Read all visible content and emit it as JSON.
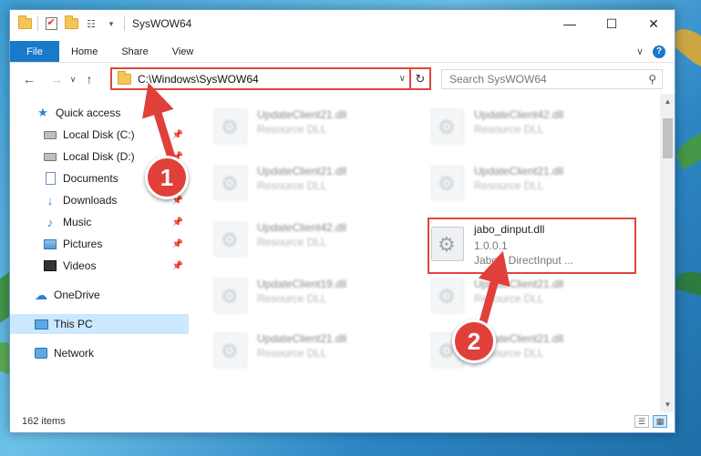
{
  "window": {
    "title": "SysWOW64",
    "controls": {
      "minimize": "—",
      "maximize": "☐",
      "close": "✕"
    }
  },
  "ribbon": {
    "tabs": [
      "File",
      "Home",
      "Share",
      "View"
    ],
    "expand": "∨",
    "help": "?"
  },
  "nav": {
    "back": "←",
    "forward": "→",
    "recent": "∨",
    "up": "↑",
    "address": "C:\\Windows\\SysWOW64",
    "address_dropdown": "∨",
    "refresh": "↻",
    "search_placeholder": "Search SysWOW64"
  },
  "sidebar": {
    "items": [
      {
        "label": "Quick access",
        "icon": "star-icon",
        "pinned": false
      },
      {
        "label": "Local Disk (C:)",
        "icon": "disk-icon",
        "pinned": true
      },
      {
        "label": "Local Disk (D:)",
        "icon": "disk-icon",
        "pinned": true
      },
      {
        "label": "Documents",
        "icon": "documents-icon",
        "pinned": true
      },
      {
        "label": "Downloads",
        "icon": "downloads-icon",
        "pinned": true
      },
      {
        "label": "Music",
        "icon": "music-icon",
        "pinned": true
      },
      {
        "label": "Pictures",
        "icon": "pictures-icon",
        "pinned": true
      },
      {
        "label": "Videos",
        "icon": "videos-icon",
        "pinned": true
      },
      {
        "label": "OneDrive",
        "icon": "onedrive-icon",
        "pinned": false
      },
      {
        "label": "This PC",
        "icon": "this-pc-icon",
        "pinned": false,
        "selected": true
      },
      {
        "label": "Network",
        "icon": "network-icon",
        "pinned": false
      }
    ],
    "pin_glyph": "📌"
  },
  "files": [
    {
      "name": "UpdateClient21.dll",
      "type": "Resource DLL"
    },
    {
      "name": "UpdateClient42.dll",
      "type": "Resource DLL"
    },
    {
      "name": "UpdateClient21.dll",
      "type": "Resource DLL"
    },
    {
      "name": "UpdateClient21.dll",
      "type": "Resource DLL"
    },
    {
      "name": "UpdateClient42.dll",
      "type": "Resource DLL"
    },
    {
      "name": "jabo_dinput.dll",
      "version": "1.0.0.1",
      "type": "Jabo's DirectInput ...",
      "highlighted": true
    },
    {
      "name": "UpdateClient19.dll",
      "type": "Resource DLL"
    },
    {
      "name": "UpdateClient21.dll",
      "type": "Resource DLL"
    },
    {
      "name": "UpdateClient21.dll",
      "type": "Resource DLL"
    },
    {
      "name": "UpdateClient21.dll",
      "type": "Resource DLL"
    }
  ],
  "status": {
    "item_count": "162 items"
  },
  "callouts": {
    "step1": "1",
    "step2": "2"
  },
  "colors": {
    "accent": "#1979ca",
    "highlight": "#e0453d",
    "selected": "#cce8ff"
  }
}
